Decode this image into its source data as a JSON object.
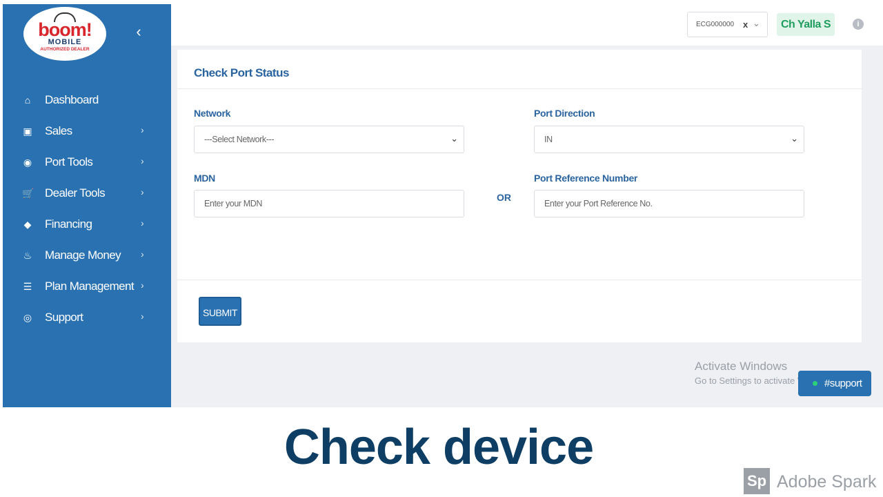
{
  "logo": {
    "word": "boom!",
    "sub": "MOBILE",
    "tag": "AUTHORIZED DEALER"
  },
  "sidebar": {
    "collapse_icon": "‹",
    "items": [
      {
        "label": "Dashboard",
        "icon": "home-icon",
        "glyph": "⌂",
        "chevron": ""
      },
      {
        "label": "Sales",
        "icon": "clipboard-icon",
        "glyph": "▣",
        "chevron": "›"
      },
      {
        "label": "Port Tools",
        "icon": "port-icon",
        "glyph": "◉",
        "chevron": "›"
      },
      {
        "label": "Dealer Tools",
        "icon": "cart-icon",
        "glyph": "🛒",
        "chevron": "›"
      },
      {
        "label": "Financing",
        "icon": "tag-icon",
        "glyph": "◆",
        "chevron": "›"
      },
      {
        "label": "Manage Money",
        "icon": "piggy-bank-icon",
        "glyph": "♨",
        "chevron": "›"
      },
      {
        "label": "Plan Management",
        "icon": "list-icon",
        "glyph": "☰",
        "chevron": "›"
      },
      {
        "label": "Support",
        "icon": "support-icon",
        "glyph": "◎",
        "chevron": "›"
      }
    ]
  },
  "header": {
    "dealer_code": "ECG000000",
    "clear_glyph": "x",
    "chevron_glyph": "⌄",
    "user_name": "Ch Yalla S",
    "info_glyph": "i"
  },
  "form": {
    "title": "Check Port Status",
    "network_label": "Network",
    "network_value": "---Select Network---",
    "direction_label": "Port Direction",
    "direction_value": "IN",
    "mdn_label": "MDN",
    "mdn_placeholder": "Enter your MDN",
    "or_label": "OR",
    "ref_label": "Port Reference Number",
    "ref_placeholder": "Enter your Port Reference No.",
    "submit_label": "SUBMIT",
    "select_chevron": "⌄"
  },
  "watermark": {
    "line1": "Activate Windows",
    "line2": "Go to Settings to activate Windows."
  },
  "support_button": "#support",
  "caption": "Check device",
  "branding": {
    "logo": "Sp",
    "text": "Adobe Spark"
  },
  "colors": {
    "sidebar": "#2a71b1",
    "accent_text": "#2a64a0",
    "user_badge_text": "#1f9d5f",
    "caption": "#0e3e64"
  }
}
